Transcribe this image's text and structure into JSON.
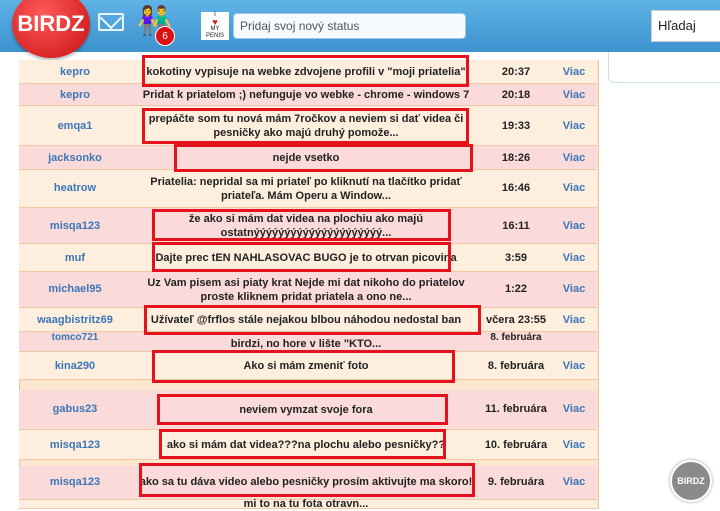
{
  "header": {
    "logo": "BIRDZ",
    "friends_count": "6",
    "penis_logo_top": "I",
    "penis_logo_bottom": "MY PENIS",
    "status_placeholder": "Pridaj svoj nový status",
    "search_label": "Hľadaj"
  },
  "rows": [
    {
      "user": "kepro",
      "message": "kokotiny vypisuje na webke zdvojene profili v \"moji priatelia\"",
      "time": "20:37",
      "more": "Viac"
    },
    {
      "user": "kepro",
      "message": "Pridat k priatelom ;) nefunguje vo webke - chrome - windows 7",
      "time": "20:18",
      "more": "Viac"
    },
    {
      "user": "emqa1",
      "message": "prepáčte som tu nová mám 7ročkov a neviem si dať videa či pesničky ako majú druhý pomože...",
      "time": "19:33",
      "more": "Viac"
    },
    {
      "user": "jacksonko",
      "message": "nejde vsetko",
      "time": "18:26",
      "more": "Viac"
    },
    {
      "user": "heatrow",
      "message": "Priatelia: nepridal sa mi priateľ po kliknutí na tlačítko pridať priateľa. Mám Operu a Window...",
      "time": "16:46",
      "more": "Viac"
    },
    {
      "user": "misqa123",
      "message": "že ako si mám dat videa na plochiu ako majú ostatnýýýýýýýýýýýýýýýýýýýýý...",
      "time": "16:11",
      "more": "Viac"
    },
    {
      "user": "muf",
      "message": "Dajte prec tEN NAHLASOVAC BUGO je to otrvan picovina",
      "time": "3:59",
      "more": "Viac"
    },
    {
      "user": "michael95",
      "message": "Uz Vam pisem asi piaty krat Nejde mi dat nikoho do priatelov proste kliknem pridat priatela a ono ne...",
      "time": "1:22",
      "more": "Viac"
    },
    {
      "user": "waagbistritz69",
      "message": "Užívateľ @frflos stále nejakou blbou náhodou nedostal ban",
      "time": "včera 23:55",
      "more": "Viac"
    },
    {
      "user": "kina290",
      "message": "Ako si mám zmeniť foto",
      "time": "8. februára",
      "more": "Viac"
    },
    {
      "user": "gabus23",
      "message": "neviem vymzat svoje fora",
      "time": "11. februára",
      "more": "Viac"
    },
    {
      "user": "misqa123",
      "message": "ako si mám dat videa???na plochu alebo pesničky??",
      "time": "10. februára",
      "more": "Viac"
    },
    {
      "user": "misqa123",
      "message": "ako sa tu dáva video alebo pesničky prosím aktivujte ma skoro!",
      "time": "9. februára",
      "more": "Viac"
    }
  ],
  "ghost_texts": {
    "g1_user": "tomco721",
    "g1_time": "8. februára",
    "g1_msg": "birdzi, no hore v lište \"KTO...",
    "g2_msg": "mi to na tu fota otravn..."
  },
  "corner_badge": "BIRDZ"
}
